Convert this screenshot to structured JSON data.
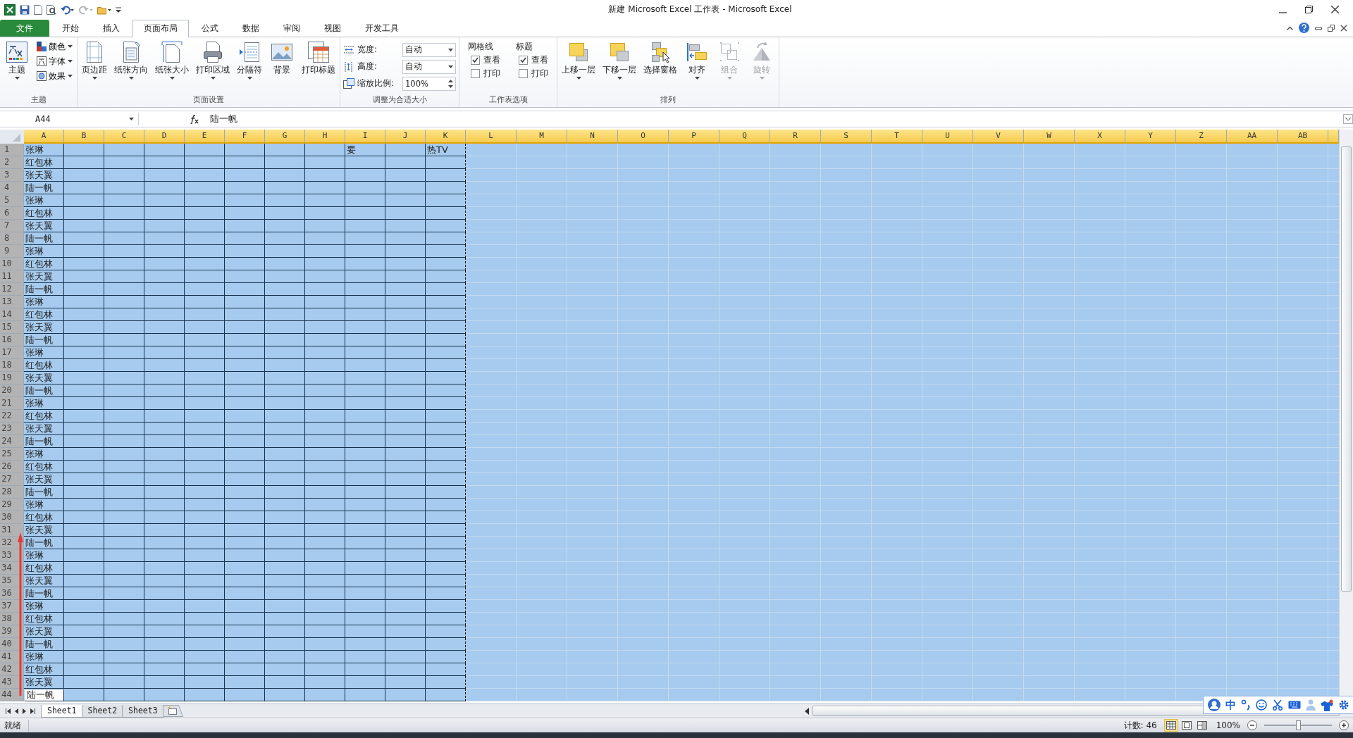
{
  "window": {
    "title": "新建 Microsoft Excel 工作表 - Microsoft Excel"
  },
  "tabs": [
    {
      "label": "文件",
      "kind": "file",
      "selected": false
    },
    {
      "label": "开始",
      "kind": "tab",
      "selected": false
    },
    {
      "label": "插入",
      "kind": "tab",
      "selected": false
    },
    {
      "label": "页面布局",
      "kind": "tab",
      "selected": true
    },
    {
      "label": "公式",
      "kind": "tab",
      "selected": false
    },
    {
      "label": "数据",
      "kind": "tab",
      "selected": false
    },
    {
      "label": "审阅",
      "kind": "tab",
      "selected": false
    },
    {
      "label": "视图",
      "kind": "tab",
      "selected": false
    },
    {
      "label": "开发工具",
      "kind": "tab",
      "selected": false
    }
  ],
  "ribbon": {
    "groups": [
      {
        "title": "主题",
        "kind": "theme",
        "buttons": [
          {
            "label": "主题",
            "dropdown": true,
            "disabled": false
          },
          {
            "label": "颜色",
            "dropdown": true,
            "disabled": false
          },
          {
            "label": "字体",
            "dropdown": true,
            "disabled": false
          },
          {
            "label": "效果",
            "dropdown": true,
            "disabled": false
          }
        ]
      },
      {
        "title": "页面设置",
        "kind": "page_setup",
        "buttons": [
          {
            "label": "页边距",
            "dropdown": true,
            "disabled": false
          },
          {
            "label": "纸张方向",
            "dropdown": true,
            "disabled": false
          },
          {
            "label": "纸张大小",
            "dropdown": true,
            "disabled": false
          },
          {
            "label": "打印区域",
            "dropdown": true,
            "disabled": false
          },
          {
            "label": "分隔符",
            "dropdown": true,
            "disabled": false
          },
          {
            "label": "背景",
            "dropdown": false,
            "disabled": false
          },
          {
            "label": "打印标题",
            "dropdown": false,
            "disabled": false
          }
        ]
      },
      {
        "title": "调整为合适大小",
        "kind": "scale",
        "fields": [
          {
            "label": "宽度:",
            "value": "自动",
            "kind": "dropdown"
          },
          {
            "label": "高度:",
            "value": "自动",
            "kind": "dropdown"
          },
          {
            "label": "缩放比例:",
            "value": "100%",
            "kind": "spinner"
          }
        ]
      },
      {
        "title": "工作表选项",
        "kind": "options",
        "sections": [
          {
            "title": "网格线",
            "checks": [
              {
                "label": "查看",
                "checked": true
              },
              {
                "label": "打印",
                "checked": false
              }
            ]
          },
          {
            "title": "标题",
            "checks": [
              {
                "label": "查看",
                "checked": true
              },
              {
                "label": "打印",
                "checked": false
              }
            ]
          }
        ]
      },
      {
        "title": "排列",
        "kind": "arrange",
        "buttons": [
          {
            "label": "上移一层",
            "dropdown": true,
            "disabled": false
          },
          {
            "label": "下移一层",
            "dropdown": true,
            "disabled": false
          },
          {
            "label": "选择窗格",
            "dropdown": false,
            "disabled": false
          },
          {
            "label": "对齐",
            "dropdown": true,
            "disabled": false
          },
          {
            "label": "组合",
            "dropdown": true,
            "disabled": true
          },
          {
            "label": "旋转",
            "dropdown": true,
            "disabled": true
          }
        ]
      }
    ]
  },
  "formula_bar": {
    "name_box": "A44",
    "formula": "陆一帆"
  },
  "columns": [
    {
      "label": "A",
      "selected": true,
      "in_print_area": true
    },
    {
      "label": "B",
      "selected": true,
      "in_print_area": true
    },
    {
      "label": "C",
      "selected": true,
      "in_print_area": true
    },
    {
      "label": "D",
      "selected": true,
      "in_print_area": true
    },
    {
      "label": "E",
      "selected": true,
      "in_print_area": true
    },
    {
      "label": "F",
      "selected": true,
      "in_print_area": true
    },
    {
      "label": "G",
      "selected": true,
      "in_print_area": true
    },
    {
      "label": "H",
      "selected": true,
      "in_print_area": true
    },
    {
      "label": "I",
      "selected": true,
      "in_print_area": true
    },
    {
      "label": "J",
      "selected": true,
      "in_print_area": true
    },
    {
      "label": "K",
      "selected": true,
      "in_print_area": true
    },
    {
      "label": "L",
      "selected": true,
      "in_print_area": false
    },
    {
      "label": "M",
      "selected": true,
      "in_print_area": false
    },
    {
      "label": "N",
      "selected": true,
      "in_print_area": false
    },
    {
      "label": "O",
      "selected": true,
      "in_print_area": false
    },
    {
      "label": "P",
      "selected": true,
      "in_print_area": false
    },
    {
      "label": "Q",
      "selected": true,
      "in_print_area": false
    },
    {
      "label": "R",
      "selected": true,
      "in_print_area": false
    },
    {
      "label": "S",
      "selected": true,
      "in_print_area": false
    },
    {
      "label": "T",
      "selected": true,
      "in_print_area": false
    },
    {
      "label": "U",
      "selected": true,
      "in_print_area": false
    },
    {
      "label": "V",
      "selected": true,
      "in_print_area": false
    },
    {
      "label": "W",
      "selected": true,
      "in_print_area": false
    },
    {
      "label": "X",
      "selected": true,
      "in_print_area": false
    },
    {
      "label": "Y",
      "selected": true,
      "in_print_area": false
    },
    {
      "label": "Z",
      "selected": true,
      "in_print_area": false
    },
    {
      "label": "AA",
      "selected": true,
      "in_print_area": false
    },
    {
      "label": "AB",
      "selected": true,
      "in_print_area": false
    }
  ],
  "rows": [
    {
      "number": "1",
      "selected": true,
      "cells": [
        {
          "text": "张琳",
          "active": false
        },
        {
          "active": false
        },
        {
          "active": false
        },
        {
          "active": false
        },
        {
          "active": false
        },
        {
          "active": false
        },
        {
          "active": false
        },
        {
          "active": false
        },
        {
          "text": "要",
          "active": false
        },
        {
          "active": false
        },
        {
          "text": "热TV",
          "active": false
        }
      ]
    },
    {
      "number": "2",
      "selected": true,
      "cells": [
        {
          "text": "红包林",
          "active": false
        }
      ]
    },
    {
      "number": "3",
      "selected": true,
      "cells": [
        {
          "text": "张天翼",
          "active": false
        }
      ]
    },
    {
      "number": "4",
      "selected": true,
      "cells": [
        {
          "text": "陆一帆",
          "active": false
        }
      ]
    },
    {
      "number": "5",
      "selected": true,
      "cells": [
        {
          "text": "张琳",
          "active": false
        }
      ]
    },
    {
      "number": "6",
      "selected": true,
      "cells": [
        {
          "text": "红包林",
          "active": false
        }
      ]
    },
    {
      "number": "7",
      "selected": true,
      "cells": [
        {
          "text": "张天翼",
          "active": false
        }
      ]
    },
    {
      "number": "8",
      "selected": true,
      "cells": [
        {
          "text": "陆一帆",
          "active": false
        }
      ]
    },
    {
      "number": "9",
      "selected": true,
      "cells": [
        {
          "text": "张琳",
          "active": false
        }
      ]
    },
    {
      "number": "10",
      "selected": true,
      "cells": [
        {
          "text": "红包林",
          "active": false
        }
      ]
    },
    {
      "number": "11",
      "selected": true,
      "cells": [
        {
          "text": "张天翼",
          "active": false
        }
      ]
    },
    {
      "number": "12",
      "selected": true,
      "cells": [
        {
          "text": "陆一帆",
          "active": false
        }
      ]
    },
    {
      "number": "13",
      "selected": true,
      "cells": [
        {
          "text": "张琳",
          "active": false
        }
      ]
    },
    {
      "number": "14",
      "selected": true,
      "cells": [
        {
          "text": "红包林",
          "active": false
        }
      ]
    },
    {
      "number": "15",
      "selected": true,
      "cells": [
        {
          "text": "张天翼",
          "active": false
        }
      ]
    },
    {
      "number": "16",
      "selected": true,
      "cells": [
        {
          "text": "陆一帆",
          "active": false
        }
      ]
    },
    {
      "number": "17",
      "selected": true,
      "cells": [
        {
          "text": "张琳",
          "active": false
        }
      ]
    },
    {
      "number": "18",
      "selected": true,
      "cells": [
        {
          "text": "红包林",
          "active": false
        }
      ]
    },
    {
      "number": "19",
      "selected": true,
      "cells": [
        {
          "text": "张天翼",
          "active": false
        }
      ]
    },
    {
      "number": "20",
      "selected": true,
      "cells": [
        {
          "text": "陆一帆",
          "active": false
        }
      ]
    },
    {
      "number": "21",
      "selected": true,
      "cells": [
        {
          "text": "张琳",
          "active": false
        }
      ]
    },
    {
      "number": "22",
      "selected": true,
      "cells": [
        {
          "text": "红包林",
          "active": false
        }
      ]
    },
    {
      "number": "23",
      "selected": true,
      "cells": [
        {
          "text": "张天翼",
          "active": false
        }
      ]
    },
    {
      "number": "24",
      "selected": true,
      "cells": [
        {
          "text": "陆一帆",
          "active": false
        }
      ]
    },
    {
      "number": "25",
      "selected": true,
      "cells": [
        {
          "text": "张琳",
          "active": false
        }
      ]
    },
    {
      "number": "26",
      "selected": true,
      "cells": [
        {
          "text": "红包林",
          "active": false
        }
      ]
    },
    {
      "number": "27",
      "selected": true,
      "cells": [
        {
          "text": "张天翼",
          "active": false
        }
      ]
    },
    {
      "number": "28",
      "selected": true,
      "cells": [
        {
          "text": "陆一帆",
          "active": false
        }
      ]
    },
    {
      "number": "29",
      "selected": true,
      "cells": [
        {
          "text": "张琳",
          "active": false
        }
      ]
    },
    {
      "number": "30",
      "selected": true,
      "cells": [
        {
          "text": "红包林",
          "active": false
        }
      ]
    },
    {
      "number": "31",
      "selected": true,
      "cells": [
        {
          "text": "张天翼",
          "active": false
        }
      ]
    },
    {
      "number": "32",
      "selected": true,
      "cells": [
        {
          "text": "陆一帆",
          "active": false
        }
      ]
    },
    {
      "number": "33",
      "selected": true,
      "cells": [
        {
          "text": "张琳",
          "active": false
        }
      ]
    },
    {
      "number": "34",
      "selected": true,
      "cells": [
        {
          "text": "红包林",
          "active": false
        }
      ]
    },
    {
      "number": "35",
      "selected": true,
      "cells": [
        {
          "text": "张天翼",
          "active": false
        }
      ]
    },
    {
      "number": "36",
      "selected": true,
      "cells": [
        {
          "text": "陆一帆",
          "active": false
        }
      ]
    },
    {
      "number": "37",
      "selected": true,
      "cells": [
        {
          "text": "张琳",
          "active": false
        }
      ]
    },
    {
      "number": "38",
      "selected": true,
      "cells": [
        {
          "text": "红包林",
          "active": false
        }
      ]
    },
    {
      "number": "39",
      "selected": true,
      "cells": [
        {
          "text": "张天翼",
          "active": false
        }
      ]
    },
    {
      "number": "40",
      "selected": true,
      "cells": [
        {
          "text": "陆一帆",
          "active": false
        }
      ]
    },
    {
      "number": "41",
      "selected": true,
      "cells": [
        {
          "text": "张琳",
          "active": false
        }
      ]
    },
    {
      "number": "42",
      "selected": true,
      "cells": [
        {
          "text": "红包林",
          "active": false
        }
      ]
    },
    {
      "number": "43",
      "selected": true,
      "cells": [
        {
          "text": "张天翼",
          "active": false
        }
      ]
    },
    {
      "number": "44",
      "selected": true,
      "cells": [
        {
          "text": "陆一帆",
          "active": true
        }
      ]
    }
  ],
  "sheets": [
    {
      "label": "Sheet1",
      "selected": true
    },
    {
      "label": "Sheet2",
      "selected": false
    },
    {
      "label": "Sheet3",
      "selected": false
    }
  ],
  "status_bar": {
    "mode": "就绪",
    "count": "计数: 46",
    "views": [
      {
        "selected": true
      },
      {
        "selected": false
      },
      {
        "selected": false
      }
    ],
    "zoom": "100%",
    "zoom_slider": {
      "level": 0.5
    }
  },
  "ime_toolbar": {
    "label": "中"
  }
}
